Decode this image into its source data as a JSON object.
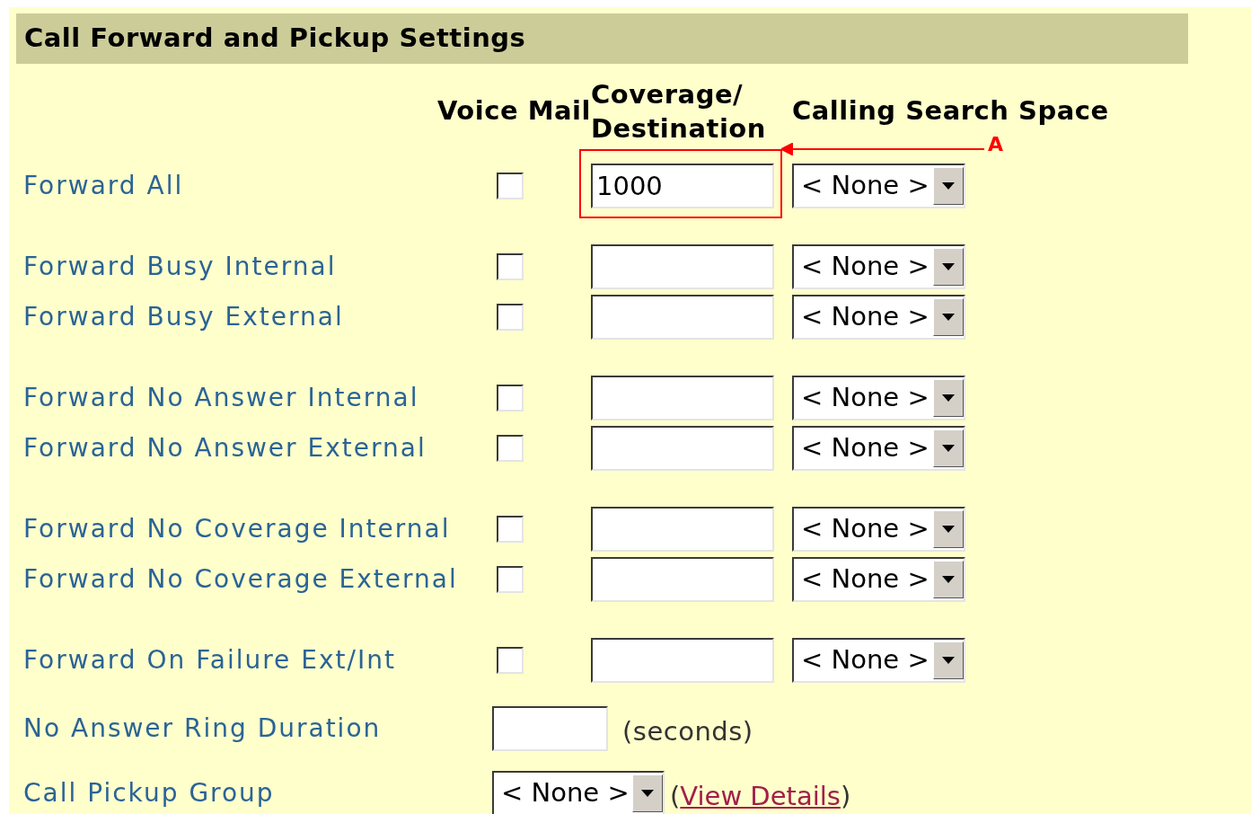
{
  "section": {
    "title": "Call Forward and Pickup Settings"
  },
  "columns": {
    "voice_mail": "Voice Mail",
    "destination": "Coverage/ Destination",
    "calling_search_space": "Calling Search Space"
  },
  "annotation": {
    "label": "A"
  },
  "groups": [
    {
      "rows": [
        {
          "label": "Forward All",
          "voice_mail_checked": false,
          "destination": "1000",
          "calling_search_space": "< None >",
          "annotated": true
        }
      ]
    },
    {
      "rows": [
        {
          "label": "Forward Busy Internal",
          "voice_mail_checked": false,
          "calling_search_space": "< None >",
          "annotated": false
        },
        {
          "label": "Forward Busy External",
          "voice_mail_checked": false,
          "calling_search_space": "< None >",
          "annotated": false
        }
      ]
    },
    {
      "rows": [
        {
          "label": "Forward No Answer Internal",
          "voice_mail_checked": false,
          "calling_search_space": "< None >",
          "annotated": false
        },
        {
          "label": "Forward No Answer External",
          "voice_mail_checked": false,
          "calling_search_space": "< None >",
          "annotated": false
        }
      ]
    },
    {
      "rows": [
        {
          "label": "Forward No Coverage Internal",
          "voice_mail_checked": false,
          "calling_search_space": "< None >",
          "annotated": false
        },
        {
          "label": "Forward No Coverage External",
          "voice_mail_checked": false,
          "calling_search_space": "< None >",
          "annotated": false
        }
      ]
    },
    {
      "rows": [
        {
          "label": "Forward On Failure Ext/Int",
          "voice_mail_checked": false,
          "calling_search_space": "< None >",
          "annotated": false
        }
      ]
    }
  ],
  "ring_duration": {
    "label": "No Answer Ring Duration",
    "unit": "(seconds)"
  },
  "pickup_group": {
    "label": "Call Pickup Group",
    "value": "< None >",
    "before": "(",
    "link": "View Details",
    "after": ")"
  }
}
